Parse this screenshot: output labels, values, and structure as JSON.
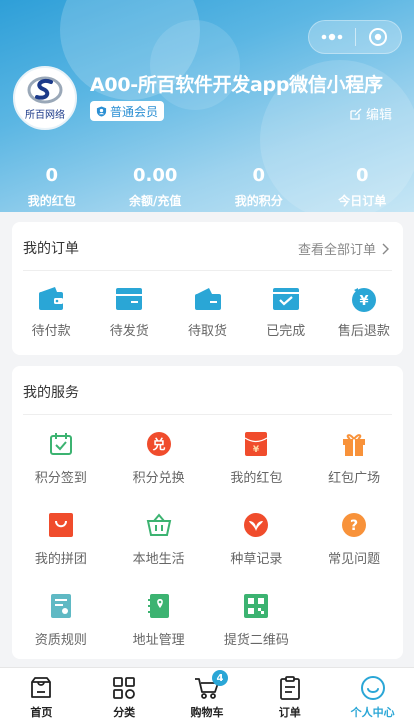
{
  "header": {
    "username": "A00-所百软件开发app微信小程序",
    "member_badge": "普通会员",
    "edit_label": "编辑",
    "avatar_text": "所百网络",
    "stats": [
      {
        "value": "0",
        "label": "我的红包"
      },
      {
        "value": "0.00",
        "label": "余额/充值"
      },
      {
        "value": "0",
        "label": "我的积分"
      },
      {
        "value": "0",
        "label": "今日订单"
      }
    ]
  },
  "orders": {
    "title": "我的订单",
    "view_all": "查看全部订单",
    "items": [
      {
        "label": "待付款",
        "icon": "wallet-icon"
      },
      {
        "label": "待发货",
        "icon": "box-icon"
      },
      {
        "label": "待取货",
        "icon": "package-icon"
      },
      {
        "label": "已完成",
        "icon": "check-box-icon"
      },
      {
        "label": "售后退款",
        "icon": "refund-icon"
      }
    ]
  },
  "services": {
    "title": "我的服务",
    "items": [
      {
        "label": "积分签到",
        "icon": "calendar-check-icon",
        "color": "#3cb371"
      },
      {
        "label": "积分兑换",
        "icon": "exchange-icon",
        "color": "#f04c2c"
      },
      {
        "label": "我的红包",
        "icon": "red-envelope-icon",
        "color": "#f04c2c"
      },
      {
        "label": "红包广场",
        "icon": "gift-icon",
        "color": "#f8923a"
      },
      {
        "label": "我的拼团",
        "icon": "shopping-bag-icon",
        "color": "#f04c2c"
      },
      {
        "label": "本地生活",
        "icon": "basket-icon",
        "color": "#3cb371"
      },
      {
        "label": "种草记录",
        "icon": "sprout-icon",
        "color": "#f04c2c"
      },
      {
        "label": "常见问题",
        "icon": "question-icon",
        "color": "#f8923a"
      },
      {
        "label": "资质规则",
        "icon": "certificate-icon",
        "color": "#5fb9c4"
      },
      {
        "label": "地址管理",
        "icon": "address-book-icon",
        "color": "#3cb371"
      },
      {
        "label": "提货二维码",
        "icon": "qrcode-icon",
        "color": "#3cb371"
      }
    ]
  },
  "tabbar": {
    "items": [
      {
        "label": "首页",
        "icon": "home-icon"
      },
      {
        "label": "分类",
        "icon": "category-icon"
      },
      {
        "label": "购物车",
        "icon": "cart-icon",
        "badge": "4"
      },
      {
        "label": "订单",
        "icon": "order-icon"
      },
      {
        "label": "个人中心",
        "icon": "smile-icon"
      }
    ]
  },
  "colors": {
    "accent": "#2aa6d6",
    "order_icon": "#2aa6d6"
  }
}
